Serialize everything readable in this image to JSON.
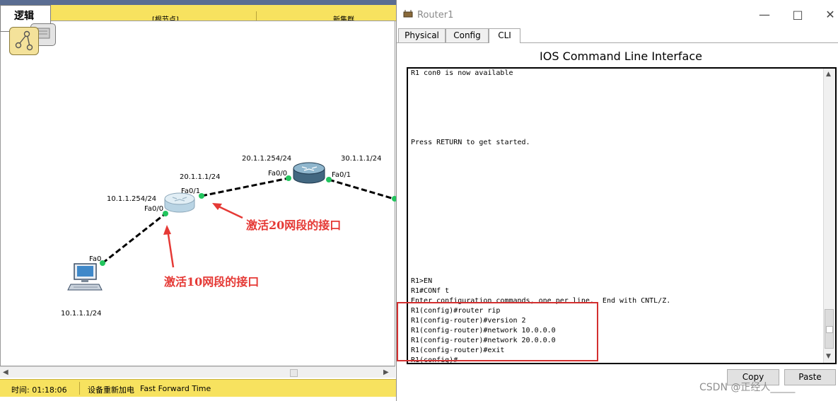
{
  "workspace": {
    "logical_tab": "逻辑",
    "root_node": "[根节点]",
    "new_cluster": "新集群",
    "status_time": "时间: 01:18:06",
    "status_power": "设备重新加电",
    "status_fft": "Fast Forward Time",
    "topology": {
      "pc_interface": "Fa0",
      "pc_ip": "10.1.1.1/24",
      "r1_fa00": "Fa0/0",
      "r1_fa00_ip": "10.1.1.254/24",
      "r1_fa01": "Fa0/1",
      "r1_fa01_ip": "20.1.1.1/24",
      "r2_fa00": "Fa0/0",
      "r2_fa00_ip": "20.1.1.254/24",
      "r2_fa01": "Fa0/1",
      "r2_fa01_ip": "30.1.1.1/24",
      "annotation_20": "激活20网段的接口",
      "annotation_10": "激活10网段的接口"
    },
    "colors": {
      "bar": "#f7e25f",
      "link_active": "#22c55e",
      "annotation": "#e53935"
    }
  },
  "router_window": {
    "title": "Router1",
    "tabs": [
      "Physical",
      "Config",
      "CLI"
    ],
    "active_tab": "CLI",
    "heading": "IOS Command Line Interface",
    "cli_lines": [
      "R1 con0 is now available",
      "",
      "",
      "",
      "",
      "",
      "",
      "Press RETURN to get started.",
      "",
      "",
      "",
      "",
      "",
      "",
      "",
      "",
      "",
      "",
      "",
      "",
      "",
      "R1>EN",
      "R1#CONf t",
      "Enter configuration commands, one per line.  End with CNTL/Z.",
      "R1(config)#router rip",
      "R1(config-router)#version 2",
      "R1(config-router)#network 10.0.0.0",
      "R1(config-router)#network 20.0.0.0",
      "R1(config-router)#exit",
      "R1(config)#"
    ],
    "copy_button": "Copy",
    "paste_button": "Paste",
    "watermark": "CSDN @正经人_____"
  }
}
